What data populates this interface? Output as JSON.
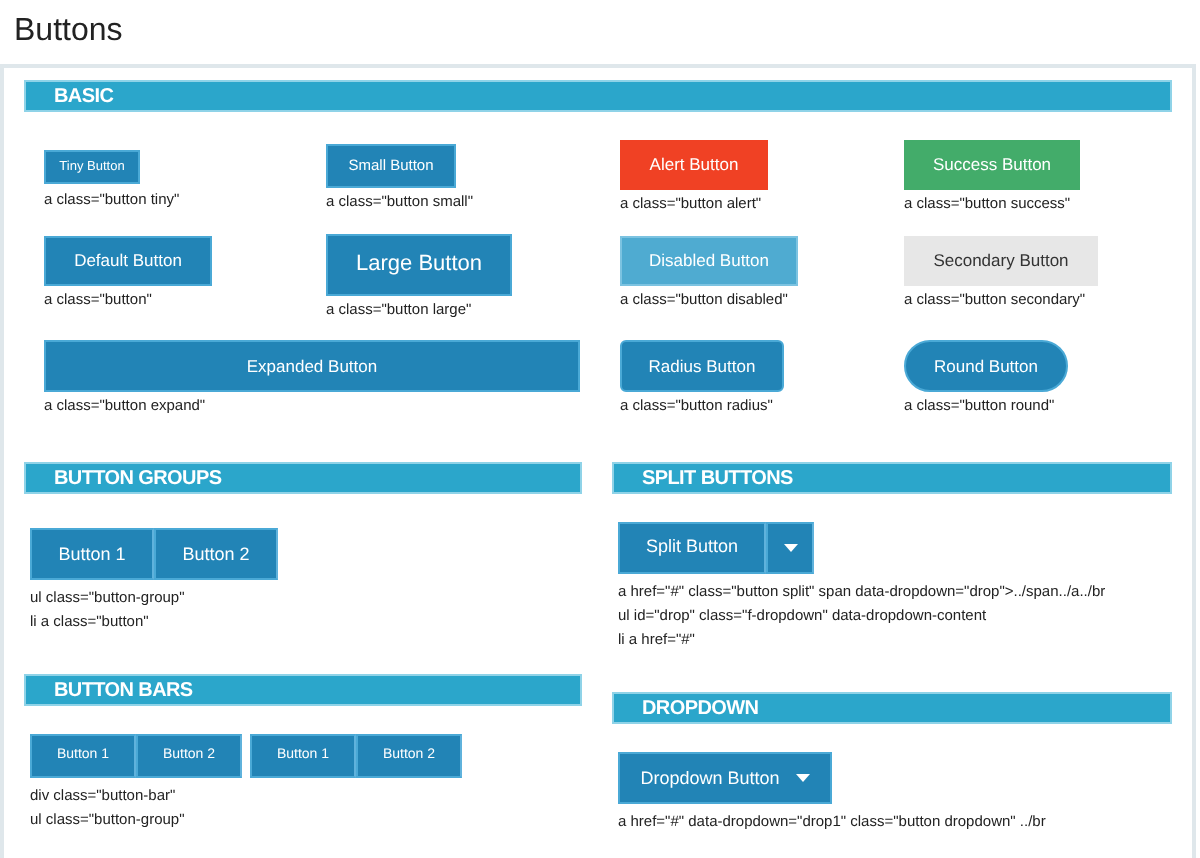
{
  "title": "Buttons",
  "basic": {
    "heading": "BASIC",
    "items": [
      {
        "kind": "tiny",
        "label": "Tiny Button",
        "code": "a class=\"button tiny\""
      },
      {
        "kind": "small",
        "label": "Small Button",
        "code": "a class=\"button small\""
      },
      {
        "kind": "alert",
        "label": "Alert Button",
        "code": "a class=\"button alert\""
      },
      {
        "kind": "success",
        "label": "Success Button",
        "code": "a class=\"button success\""
      },
      {
        "kind": "default",
        "label": "Default Button",
        "code": "a class=\"button\""
      },
      {
        "kind": "large",
        "label": "Large Button",
        "code": "a class=\"button large\""
      },
      {
        "kind": "disabled",
        "label": "Disabled Button",
        "code": "a class=\"button disabled\""
      },
      {
        "kind": "secondary",
        "label": "Secondary Button",
        "code": "a class=\"button secondary\""
      },
      {
        "kind": "expand",
        "label": "Expanded Button",
        "code": "a class=\"button expand\""
      },
      {
        "kind": "radius",
        "label": "Radius Button",
        "code": "a class=\"button radius\""
      },
      {
        "kind": "round",
        "label": "Round Button",
        "code": "a class=\"button round\""
      }
    ]
  },
  "button_groups": {
    "heading": "BUTTON GROUPS",
    "groups": [
      [
        "Button 1",
        "Button 2"
      ]
    ],
    "code": [
      "ul class=\"button-group\"",
      "li a class=\"button\""
    ]
  },
  "button_bars": {
    "heading": "BUTTON BARS",
    "groups": [
      [
        "Button 1",
        "Button 2"
      ],
      [
        "Button 1",
        "Button 2"
      ]
    ],
    "code": [
      "div class=\"button-bar\"",
      "ul class=\"button-group\""
    ]
  },
  "split_buttons": {
    "heading": "SPLIT BUTTONS",
    "label": "Split Button",
    "code": [
      "a href=\"#\" class=\"button split\" span data-dropdown=\"drop\">../span../a../br",
      "ul id=\"drop\" class=\"f-dropdown\" data-dropdown-content",
      "li a href=\"#\""
    ]
  },
  "dropdown": {
    "heading": "DROPDOWN",
    "label": "Dropdown Button",
    "code": [
      "a href=\"#\" data-dropdown=\"drop1\" class=\"button dropdown\" ../br"
    ]
  }
}
